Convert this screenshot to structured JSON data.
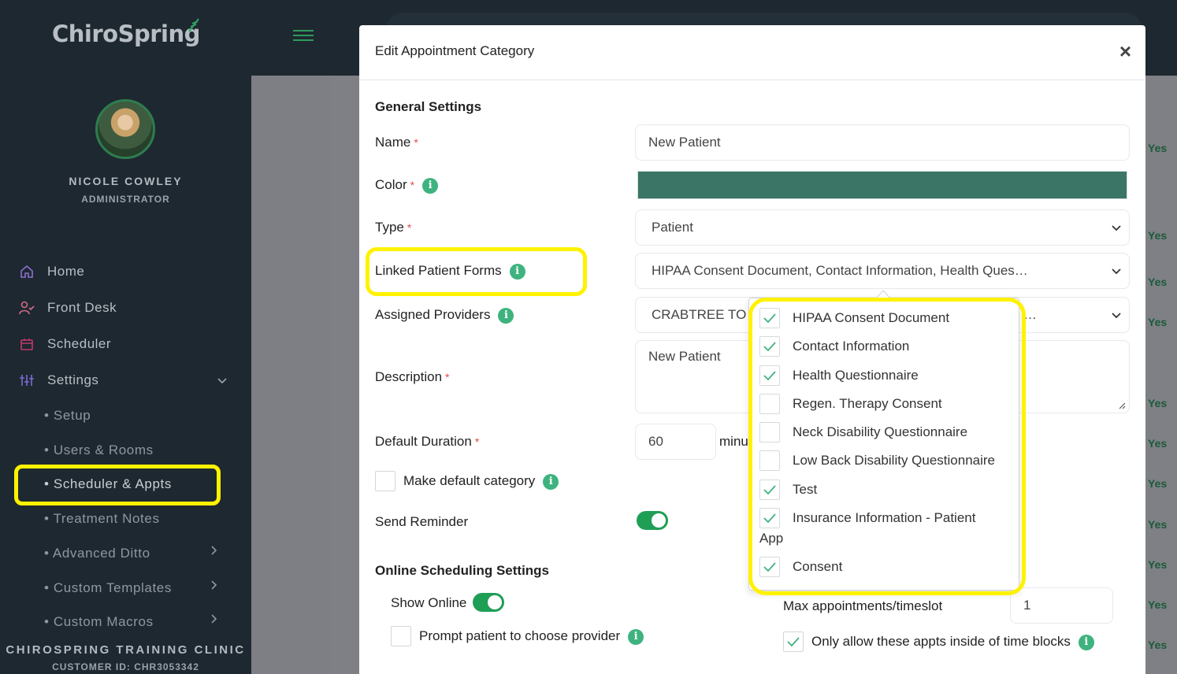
{
  "brand": {
    "logo_text": "ChiroSpring"
  },
  "user": {
    "name": "NICOLE COWLEY",
    "role": "ADMINISTRATOR"
  },
  "nav": {
    "items": [
      {
        "label": "Home",
        "icon": "home-icon"
      },
      {
        "label": "Front Desk",
        "icon": "front-desk-icon"
      },
      {
        "label": "Scheduler",
        "icon": "calendar-icon"
      },
      {
        "label": "Settings",
        "icon": "sliders-icon"
      }
    ],
    "settings_sub": [
      {
        "label": "• Setup"
      },
      {
        "label": "• Users & Rooms"
      },
      {
        "label": "• Scheduler & Appts"
      },
      {
        "label": "• Treatment Notes"
      },
      {
        "label": "• Advanced Ditto"
      },
      {
        "label": "• Custom Templates"
      },
      {
        "label": "• Custom Macros"
      }
    ]
  },
  "clinic": {
    "name": "CHIROSPRING TRAINING CLINIC",
    "customer_id": "CUSTOMER ID: CHR3053342"
  },
  "background": {
    "yes_text": "Yes"
  },
  "modal": {
    "title": "Edit Appointment Category",
    "close": "×",
    "general_settings": "General Settings",
    "name_label": "Name",
    "name_value": "New Patient",
    "color_label": "Color",
    "color_value": "#3a7565",
    "type_label": "Type",
    "type_value": "Patient",
    "linked_forms_label": "Linked Patient Forms",
    "linked_forms_value": "HIPAA Consent Document, Contact Information, Health Ques…",
    "providers_label": "Assigned Providers",
    "providers_value": "CRABTREE TO",
    "providers_suffix": "…",
    "description_label": "Description",
    "description_value": "New Patient",
    "duration_label": "Default Duration",
    "duration_value": "60",
    "duration_unit": "minu",
    "make_default_label": "Make default category",
    "send_reminder_label": "Send Reminder",
    "online_settings": "Online Scheduling Settings",
    "show_online_label": "Show Online",
    "prompt_provider_label": "Prompt patient to choose provider",
    "max_appts_label": "Max appointments/timeslot",
    "max_appts_value": "1",
    "only_allow_label": "Only allow these appts inside of time blocks",
    "required_mark": "*",
    "info_glyph": "i"
  },
  "forms_dropdown": {
    "options": [
      {
        "label": "HIPAA Consent Document",
        "checked": true
      },
      {
        "label": "Contact Information",
        "checked": true
      },
      {
        "label": "Health Questionnaire",
        "checked": true
      },
      {
        "label": "Regen. Therapy Consent",
        "checked": false
      },
      {
        "label": "Neck Disability Questionnaire",
        "checked": false
      },
      {
        "label": "Low Back Disability Questionnaire",
        "checked": false
      },
      {
        "label": "Test",
        "checked": true
      },
      {
        "label": "Insurance Information - Patient",
        "label_wrap": "App",
        "checked": true
      },
      {
        "label": "Consent",
        "checked": true
      }
    ]
  },
  "colors": {
    "accent": "#1f9e56",
    "highlight": "#fff200",
    "sidebar": "#1e2830",
    "info": "#3fb37f"
  }
}
